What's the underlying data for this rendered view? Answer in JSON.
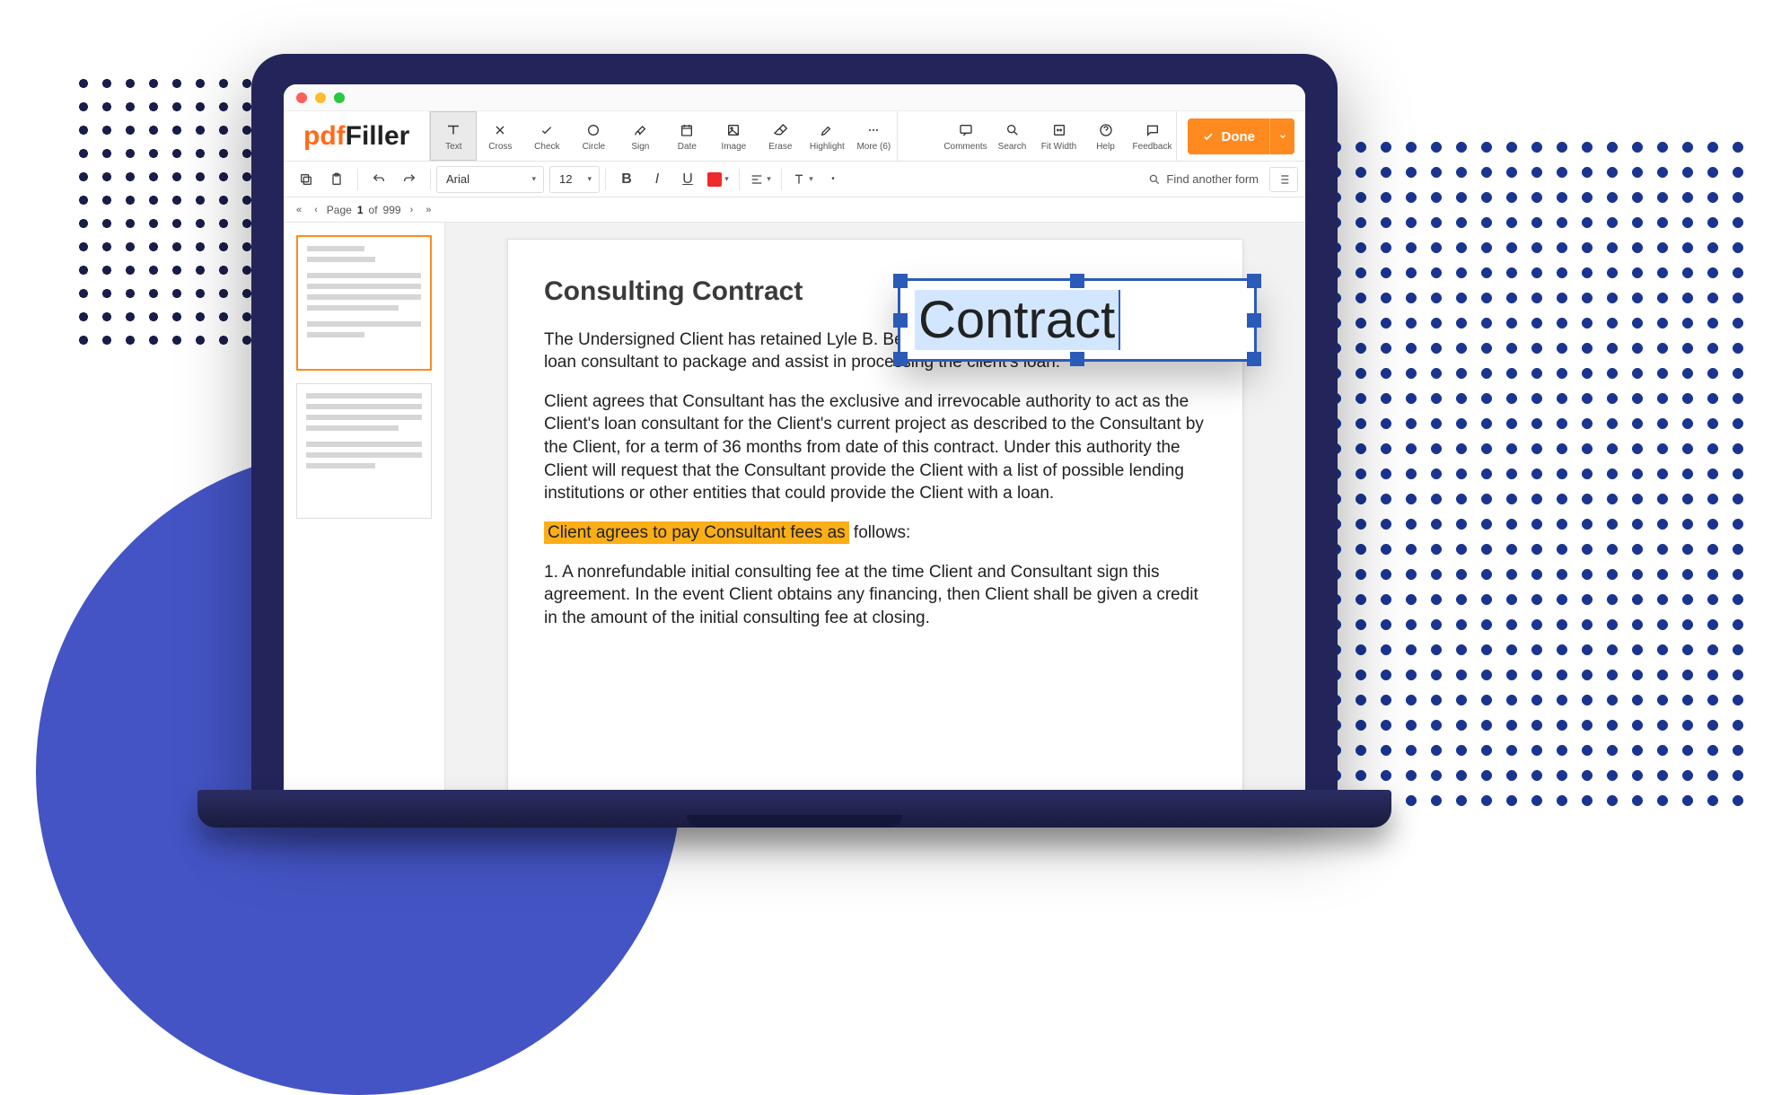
{
  "logo": {
    "prefix": "pdf",
    "suffix": "Filler"
  },
  "toolbar": {
    "tools": [
      {
        "id": "text",
        "label": "Text",
        "active": true
      },
      {
        "id": "cross",
        "label": "Cross"
      },
      {
        "id": "check",
        "label": "Check"
      },
      {
        "id": "circle",
        "label": "Circle"
      },
      {
        "id": "sign",
        "label": "Sign"
      },
      {
        "id": "date",
        "label": "Date"
      },
      {
        "id": "image",
        "label": "Image"
      },
      {
        "id": "erase",
        "label": "Erase"
      },
      {
        "id": "highlight",
        "label": "Highlight"
      },
      {
        "id": "more",
        "label": "More (6)"
      }
    ],
    "right": [
      {
        "id": "comments",
        "label": "Comments"
      },
      {
        "id": "search",
        "label": "Search"
      },
      {
        "id": "fitwidth",
        "label": "Fit Width"
      },
      {
        "id": "help",
        "label": "Help"
      },
      {
        "id": "feedback",
        "label": "Feedback"
      }
    ],
    "done": "Done"
  },
  "format": {
    "font": "Arial",
    "size": "12"
  },
  "find_form": "Find another form",
  "pagenav": {
    "prefix": "Page",
    "current": "1",
    "sep": "of",
    "total": "999"
  },
  "document": {
    "title": "Consulting Contract",
    "p1": "The Undersigned Client has retained Lyle B. Benson (hereinafter \"Consultant\") as a loan consultant to package and assist in processing the client's loan.",
    "p2": "Client agrees that Consultant has the exclusive and irrevocable authority to act as the Client's loan consultant for the Client's current project as described to the Consultant by the Client, for a term of 36 months from date of this contract. Under this authority the Client will request that the Consultant provide the Client with a list of possible lending institutions or other entities that could provide the Client with a loan.",
    "highlighted": "Client agrees to pay Consultant fees as",
    "after_highlight": " follows:",
    "p4": "1. A nonrefundable initial consulting fee at the time Client and Consultant sign this agreement. In the event Client obtains any financing, then Client shall be given a credit in the amount of the initial consulting fee at closing."
  },
  "floating_text": "Contract"
}
